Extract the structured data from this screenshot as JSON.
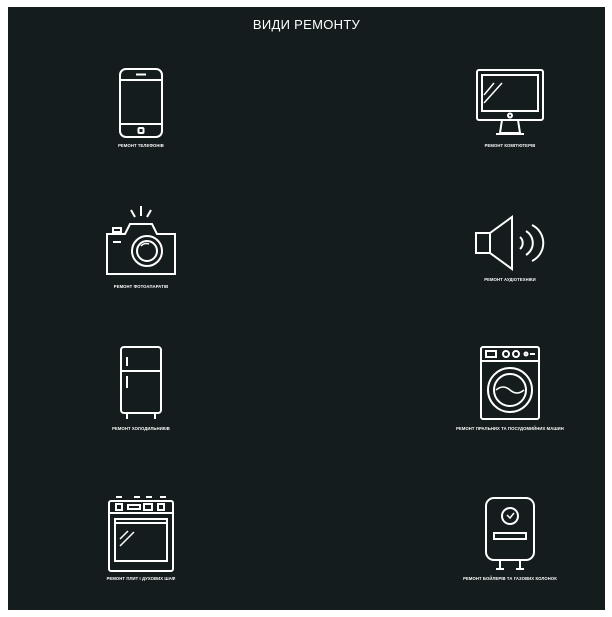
{
  "page": {
    "title": "ВИДИ РЕМОНТУ",
    "background": "#141c1d",
    "foreground": "#ffffff"
  },
  "services": [
    {
      "icon": "smartphone-icon",
      "label": "РЕМОНТ ТЕЛЕФОНІВ"
    },
    {
      "icon": "monitor-icon",
      "label": "РЕМОНТ КОМП'ЮТЕРІВ"
    },
    {
      "icon": "camera-icon",
      "label": "РЕМОНТ ФОТОАПАРАТІВ"
    },
    {
      "icon": "speaker-icon",
      "label": "РЕМОНТ АУДІОТЕХНІКИ"
    },
    {
      "icon": "refrigerator-icon",
      "label": "РЕМОНТ ХОЛОДИЛЬНИКІВ"
    },
    {
      "icon": "washing-machine-icon",
      "label": "РЕМОНТ ПРАЛЬНИХ ТА ПОСУДОМИЙНИХ МАШИН"
    },
    {
      "icon": "oven-icon",
      "label": "РЕМОНТ ПЛИТ І ДУХОВИХ ШАФ"
    },
    {
      "icon": "water-heater-icon",
      "label": "РЕМОНТ БОЙЛЕРІВ ТА ГАЗОВИХ КОЛОНОК"
    }
  ]
}
